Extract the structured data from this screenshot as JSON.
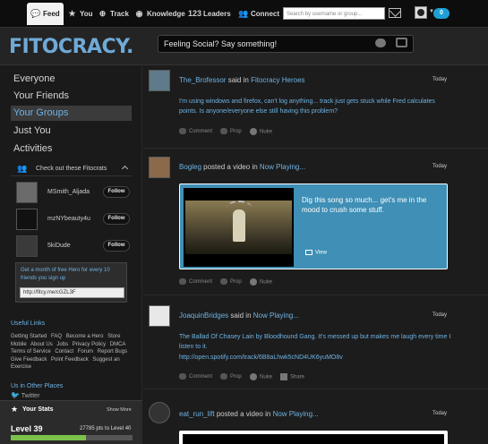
{
  "nav": {
    "items": [
      {
        "label": "Feed",
        "icon": "speech-bubble-icon",
        "active": true
      },
      {
        "label": "You",
        "icon": "star-icon"
      },
      {
        "label": "Track",
        "icon": "track-icon"
      },
      {
        "label": "Knowledge",
        "icon": "knowledge-icon"
      },
      {
        "label": "Leaders",
        "icon": "leaders-icon"
      },
      {
        "label": "Connect",
        "icon": "people-icon"
      }
    ],
    "search_placeholder": "Search by username or group...",
    "notification_count": "0"
  },
  "header": {
    "logo": "FITOCRACY.",
    "status_placeholder": "Feeling Social? Say something!"
  },
  "sidebar": {
    "nav": [
      "Everyone",
      "Your Friends",
      "Your Groups",
      "Just You",
      "Activities"
    ],
    "active": "Your Groups",
    "fitocrats_title": "Check out these Fitocrats",
    "fitocrats": [
      {
        "name": "MSmith_Aljada",
        "follow": "Follow"
      },
      {
        "name": "mzNYbeauty4u",
        "follow": "Follow"
      },
      {
        "name": "5kiDude",
        "follow": "Follow"
      }
    ],
    "hero_text": "Get a month of free Hero for every 10 friends you sign up",
    "hero_link": "http://fitcy.me/cGZL3F",
    "useful_links_title": "Useful Links",
    "useful_links": [
      "Getting Started",
      "FAQ",
      "Become a Hero",
      "Store",
      "Mobile",
      "About Us",
      "Jobs",
      "Privacy Policy",
      "DMCA",
      "Terms of Service",
      "Contact",
      "Forum",
      "Report Bugs",
      "Give Feedback",
      "Point Feedback",
      "Suggest an Exercise"
    ],
    "other_places_title": "Us in Other Places",
    "twitter": "Twitter",
    "stats": {
      "title": "Your Stats",
      "show_more": "Show More",
      "level": "Level 39",
      "points_text": "27785 pts to Level 40",
      "progress": 0.62
    }
  },
  "feed": {
    "actions": {
      "comment": "Comment",
      "prop": "Prop",
      "nuke": "Nuke",
      "share": "Share"
    },
    "posts": [
      {
        "user": "The_Brofessor",
        "verb": "said in",
        "group": "Fitocracy Heroes",
        "time": "Today",
        "body": "I'm using windows and firefox, can't log anything... track just gets stuck while Fred calculates points. Is anyone/everyone else still having this problem?"
      },
      {
        "user": "Bogleg",
        "verb": "posted a video",
        "in": "in",
        "group": "Now Playing...",
        "time": "Today",
        "video_text": "Dig this song so much... get's me in the mood to crush some stuff.",
        "view": "View"
      },
      {
        "user": "JoaquinBridges",
        "verb": "said in",
        "group": "Now Playing...",
        "time": "Today",
        "body": "The Ballad Of Chasey Lain by Bloodhound Gang. It's messed up but makes me laugh every time I listen to it.",
        "link": "http://open.spotify.com/track/6B8aLhwk5cND4UK6yuMO8v"
      },
      {
        "user": "eat_run_lift",
        "verb": "posted a video",
        "in": "in",
        "group": "Now Playing...",
        "time": "Today"
      }
    ]
  }
}
